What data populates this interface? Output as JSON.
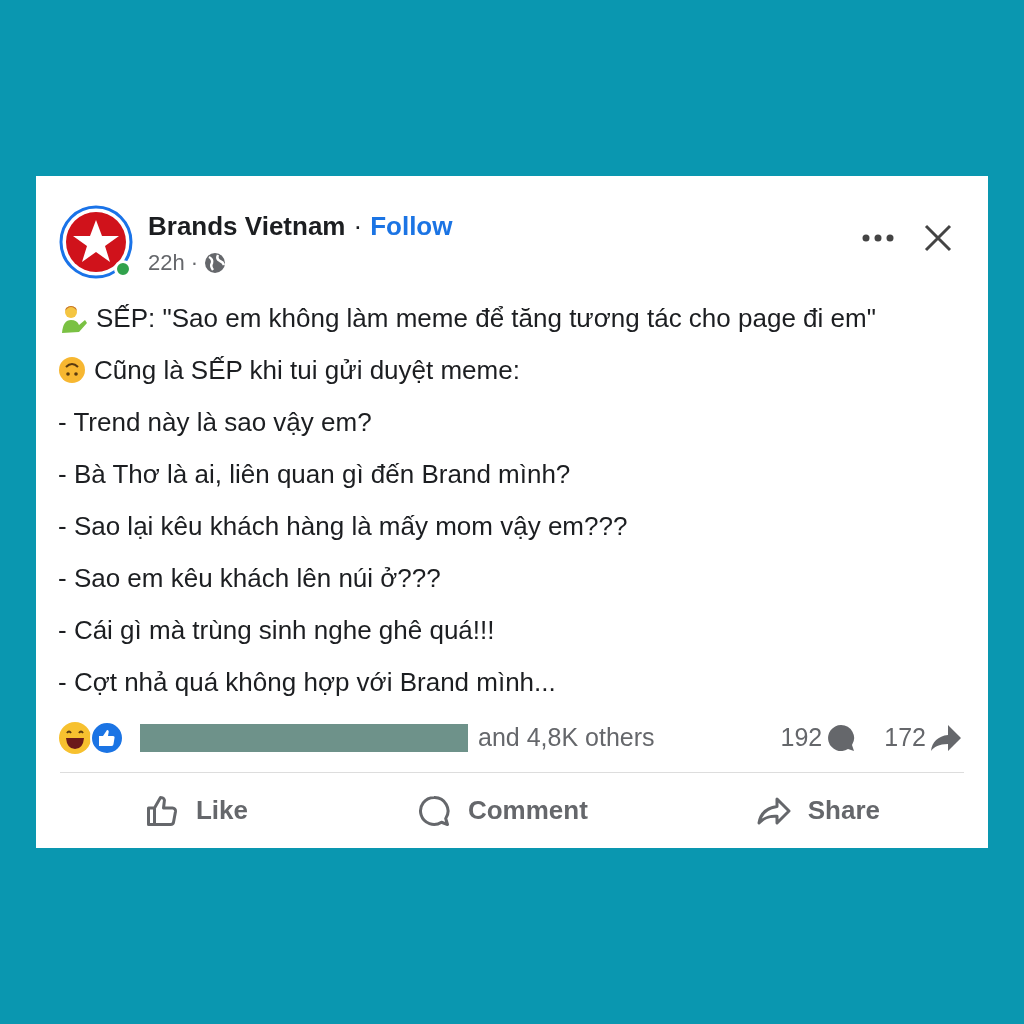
{
  "post": {
    "author": "Brands Vietnam",
    "separator": "·",
    "follow": "Follow",
    "time": "22h",
    "time_separator": "·",
    "online": true,
    "lines": [
      {
        "kind": "man",
        "text": "SẾP: \"Sao em không làm meme để tăng tương tác cho page đi em\""
      },
      {
        "kind": "upside",
        "text": "Cũng là SẾP khi tui gửi duyệt meme:"
      },
      {
        "kind": "plain",
        "text": "- Trend này là sao vậy em?"
      },
      {
        "kind": "plain",
        "text": "- Bà Thơ là ai, liên quan gì đến Brand mình?"
      },
      {
        "kind": "plain",
        "text": "- Sao lại kêu khách hàng là mấy mom vậy em???"
      },
      {
        "kind": "plain",
        "text": "- Sao em kêu khách lên núi ở???"
      },
      {
        "kind": "plain",
        "text": "- Cái gì mà trùng sinh nghe ghê quá!!!"
      },
      {
        "kind": "plain",
        "text": "- Cợt nhả quá không hợp với Brand mình..."
      }
    ],
    "reactions_text": "and 4,8K others",
    "comments": "192",
    "shares": "172",
    "actions": [
      {
        "kind": "like",
        "label": "Like"
      },
      {
        "kind": "comment",
        "label": "Comment"
      },
      {
        "kind": "share",
        "label": "Share"
      }
    ]
  }
}
